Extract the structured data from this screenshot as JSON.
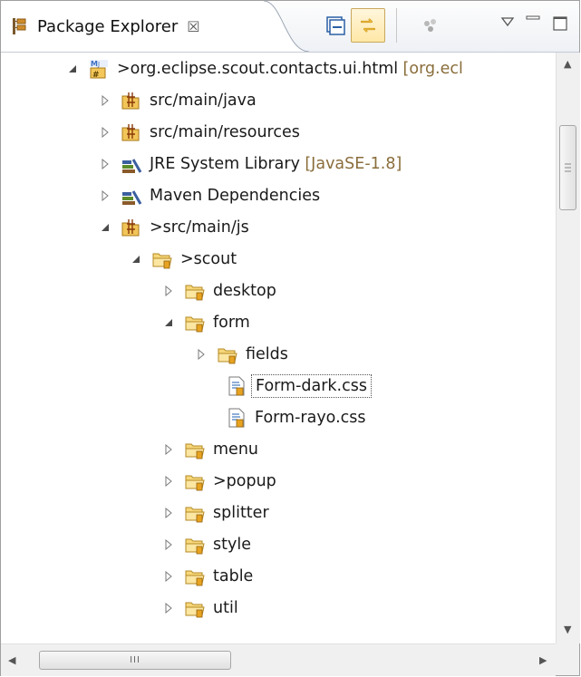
{
  "view": {
    "title": "Package Explorer",
    "close_glyph": "☒",
    "toolbar": {
      "collapse_all": "collapse-all-icon",
      "link_with_editor": "link-with-editor-icon",
      "focus": "focus-icon",
      "view_menu": "view-menu-icon",
      "minimize": "minimize-icon",
      "maximize": "maximize-icon"
    }
  },
  "tree": [
    {
      "label": "org.eclipse.scout.contacts.ui.html",
      "prefix": "> ",
      "decoration": "[org.ecl",
      "icon": "maven-project-icon",
      "expanded": true
    },
    {
      "label": "src/main/java",
      "icon": "source-folder-icon",
      "expanded": false
    },
    {
      "label": "src/main/resources",
      "icon": "source-folder-icon",
      "expanded": false
    },
    {
      "label": "JRE System Library",
      "decoration": "[JavaSE-1.8]",
      "icon": "library-icon",
      "expanded": false
    },
    {
      "label": "Maven Dependencies",
      "icon": "library-icon",
      "expanded": false
    },
    {
      "label": "src/main/js",
      "prefix": "> ",
      "icon": "source-folder-icon",
      "expanded": true
    },
    {
      "label": "scout",
      "prefix": "> ",
      "icon": "folder-icon",
      "expanded": true
    },
    {
      "label": "desktop",
      "icon": "folder-icon",
      "expanded": false
    },
    {
      "label": "form",
      "icon": "folder-icon",
      "expanded": true
    },
    {
      "label": "fields",
      "icon": "folder-icon",
      "expanded": false
    },
    {
      "label": "Form-dark.css",
      "icon": "css-file-icon",
      "selected": true
    },
    {
      "label": "Form-rayo.css",
      "icon": "css-file-icon"
    },
    {
      "label": "menu",
      "icon": "folder-icon",
      "expanded": false
    },
    {
      "label": "popup",
      "prefix": "> ",
      "icon": "folder-icon",
      "expanded": false
    },
    {
      "label": "splitter",
      "icon": "folder-icon",
      "expanded": false
    },
    {
      "label": "style",
      "icon": "folder-icon",
      "expanded": false
    },
    {
      "label": "table",
      "icon": "folder-icon",
      "expanded": false
    },
    {
      "label": "util",
      "icon": "folder-icon",
      "expanded": false
    }
  ],
  "scrollbar": {
    "h_thumb_grip": "III"
  }
}
